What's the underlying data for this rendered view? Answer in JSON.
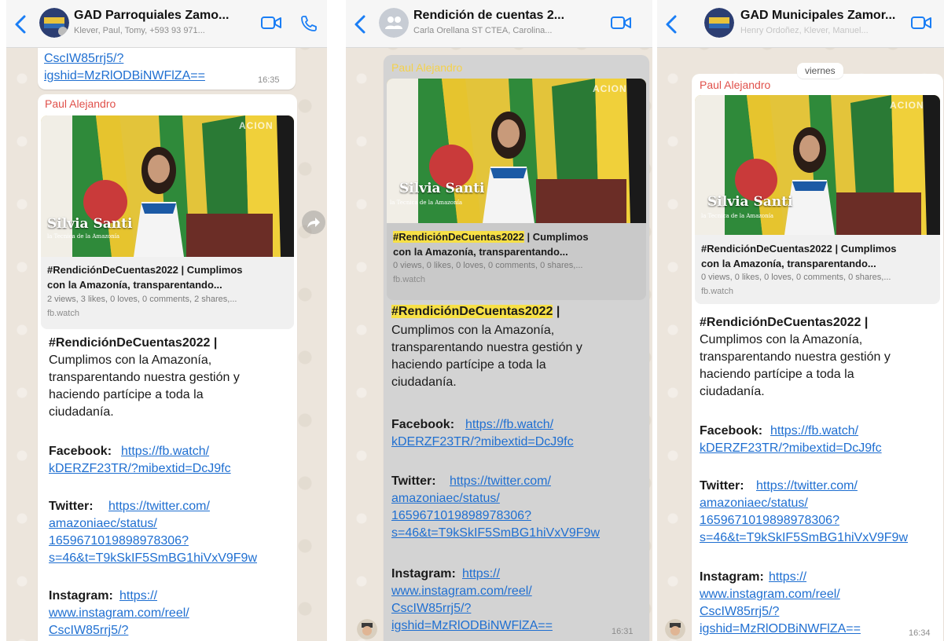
{
  "phone1": {
    "title": "GAD Parroquiales Zamo...",
    "subtitle": "Klever, Paul, Tomy, +593 93 971...",
    "top_link_a": "CscIW85rrj5/?",
    "top_link_b": "igshid=MzRlODBiNWFlZA==",
    "top_time": "16:35",
    "sender": "Paul Alejandro",
    "image_name": "Silvia Santi",
    "image_caption": "la Tecnica de la Amazonía",
    "image_banner": "ACION",
    "preview_title_a": "#RendiciónDeCuentas2022 | Cumplimos",
    "preview_title_b": "con la Amazonía, transparentando...",
    "preview_stats": "2 views, 3 likes, 0 loves, 0 comments, 2 shares,...",
    "preview_host": "fb.watch",
    "hashtag": "#RendiciónDeCuentas2022 |",
    "body_lines": [
      "Cumplimos con la Amazonía,",
      "transparentando nuestra gestión y",
      "haciendo partícipe a toda la",
      "ciudadanía."
    ],
    "facebook_label": "Facebook:",
    "facebook_link_a": "https://fb.watch/",
    "facebook_link_b": "kDERZF23TR/?mibextid=DcJ9fc",
    "twitter_label": "Twitter:",
    "twitter_link_a": "https://twitter.com/",
    "twitter_link_b": "amazoniaec/status/",
    "twitter_link_c": "1659671019898978306?",
    "twitter_link_d": "s=46&t=T9kSkIF5SmBG1hiVxV9F9w",
    "instagram_label": "Instagram:",
    "instagram_link_a": "https://",
    "instagram_link_b": "www.instagram.com/reel/",
    "instagram_link_c": "CscIW85rrj5/?"
  },
  "phone2": {
    "title": "Rendición de cuentas 2...",
    "subtitle": "Carla Orellana ST CTEA, Carolina...",
    "sender": "Paul Alejandro",
    "image_name": "Silvia Santi",
    "image_caption": "la Tecnica de la Amazonía",
    "image_banner": "ACION",
    "preview_title_hl": "#RendiciónDeCuentas2022",
    "preview_title_rest": " | Cumplimos",
    "preview_title_b": "con la Amazonía, transparentando...",
    "preview_stats": "0 views, 0 likes, 0 loves, 0 comments, 0 shares,...",
    "preview_host": "fb.watch",
    "hashtag": "#RendiciónDeCuentas2022",
    "hashtag_tail": " |",
    "body_lines": [
      "Cumplimos con la Amazonía,",
      "transparentando nuestra gestión y",
      "haciendo partícipe a toda la",
      "ciudadanía."
    ],
    "facebook_label": "Facebook:",
    "facebook_link_a": "https://fb.watch/",
    "facebook_link_b": "kDERZF23TR/?mibextid=DcJ9fc",
    "twitter_label": "Twitter:",
    "twitter_link_a": "https://twitter.com/",
    "twitter_link_b": "amazoniaec/status/",
    "twitter_link_c": "1659671019898978306?",
    "twitter_link_d": "s=46&t=T9kSkIF5SmBG1hiVxV9F9w",
    "instagram_label": "Instagram:",
    "instagram_link_a": "https://",
    "instagram_link_b": "www.instagram.com/reel/",
    "instagram_link_c": "CscIW85rrj5/?",
    "instagram_link_d": "igshid=MzRlODBiNWFlZA==",
    "time": "16:31"
  },
  "phone3": {
    "title": "GAD Municipales Zamor...",
    "subtitle": "Henry Ordoñez, Klever, Manuel...",
    "date_chip": "viernes",
    "sender": "Paul Alejandro",
    "image_name": "Silvia Santi",
    "image_caption": "la Tecnica de la Amazonía",
    "image_banner": "ACION",
    "preview_title_a": "#RendiciónDeCuentas2022 | Cumplimos",
    "preview_title_b": "con la Amazonía, transparentando...",
    "preview_stats": "0 views, 0 likes, 0 loves, 0 comments, 0 shares,...",
    "preview_host": "fb.watch",
    "hashtag": "#RendiciónDeCuentas2022 |",
    "body_lines": [
      "Cumplimos con la Amazonía,",
      "transparentando nuestra gestión y",
      "haciendo partícipe a toda la",
      "ciudadanía."
    ],
    "facebook_label": "Facebook:",
    "facebook_link_a": "https://fb.watch/",
    "facebook_link_b": "kDERZF23TR/?mibextid=DcJ9fc",
    "twitter_label": "Twitter:",
    "twitter_link_a": "https://twitter.com/",
    "twitter_link_b": "amazoniaec/status/",
    "twitter_link_c": "1659671019898978306?",
    "twitter_link_d": "s=46&t=T9kSkIF5SmBG1hiVxV9F9w",
    "instagram_label": "Instagram:",
    "instagram_link_a": "https://",
    "instagram_link_b": "www.instagram.com/reel/",
    "instagram_link_c": "CscIW85rrj5/?",
    "instagram_link_d": "igshid=MzRlODBiNWFlZA==",
    "time": "16:34"
  },
  "icons": {
    "back": "chevron-left-icon",
    "video": "video-camera-icon",
    "phone": "phone-icon",
    "forward": "forward-arrow-icon",
    "group": "group-avatar-icon"
  },
  "colors": {
    "link": "#1f6fd1",
    "sender": "#e0504a",
    "highlight": "#f7e046",
    "ios_blue": "#1a7ef5"
  }
}
